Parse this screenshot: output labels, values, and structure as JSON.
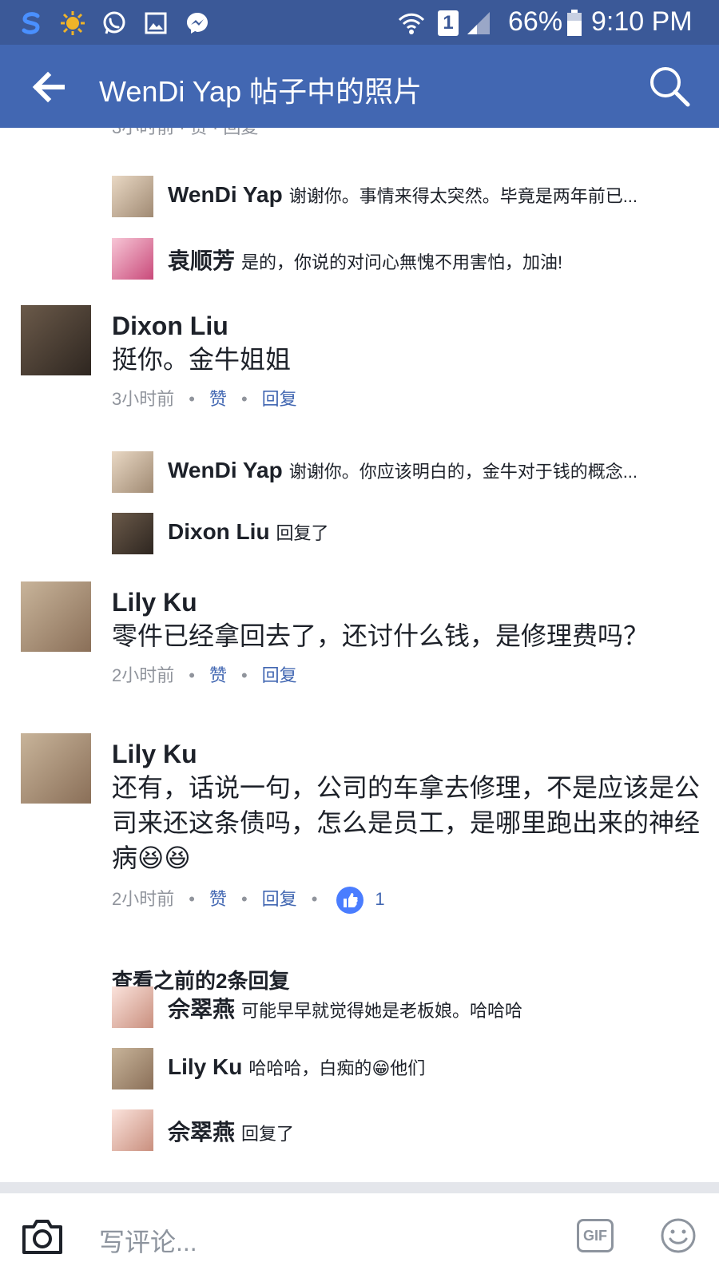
{
  "status_bar": {
    "battery": "66%",
    "time": "9:10 PM",
    "sim_label": "1",
    "icons": [
      "s-app-icon",
      "sun-icon",
      "whatsapp-icon",
      "gallery-icon",
      "messenger-icon",
      "wifi-icon",
      "sim-icon",
      "signal-icon",
      "battery-icon"
    ]
  },
  "app_bar": {
    "title": "WenDi Yap 帖子中的照片",
    "back_icon": "back-arrow-icon",
    "search_icon": "search-icon",
    "background": "#4267b2"
  },
  "comments": [
    {
      "replies": [
        {
          "name": "WenDi Yap",
          "text": "谢谢你。事情来得太突然。毕竟是两年前已..."
        },
        {
          "name": "袁顺芳",
          "text": "是的，你说的对问心無愧不用害怕，加油!"
        }
      ]
    },
    {
      "name": "Dixon Liu",
      "text": "挺你。金牛姐姐",
      "time": "3小时前",
      "like": "赞",
      "reply": "回复",
      "replies": [
        {
          "name": "WenDi Yap",
          "text": "谢谢你。你应该明白的，金牛对于钱的概念..."
        },
        {
          "name": "Dixon Liu",
          "text": "回复了"
        }
      ]
    },
    {
      "name": "Lily Ku",
      "text": "零件已经拿回去了，还讨什么钱，是修理费吗？",
      "time": "2小时前",
      "like": "赞",
      "reply": "回复"
    },
    {
      "name": "Lily Ku",
      "text": "还有，话说一句，公司的车拿去修理，不是应该是公司来还这条债吗，怎么是员工，是哪里跑出来的神经病😆😆",
      "time": "2小时前",
      "like": "赞",
      "reply": "回复",
      "like_count": "1",
      "view_previous": "查看之前的2条回复",
      "replies": [
        {
          "name": "佘翠燕",
          "text": "可能早早就觉得她是老板娘。哈哈哈"
        },
        {
          "name": "Lily Ku",
          "text": "哈哈哈，白痴的😁他们"
        },
        {
          "name": "佘翠燕",
          "text": "回复了"
        }
      ]
    }
  ],
  "composer": {
    "placeholder": "写评论...",
    "gif_label": "GIF"
  },
  "colors": {
    "link": "#4267b2",
    "meta": "#90949c",
    "text": "#1d2129"
  }
}
